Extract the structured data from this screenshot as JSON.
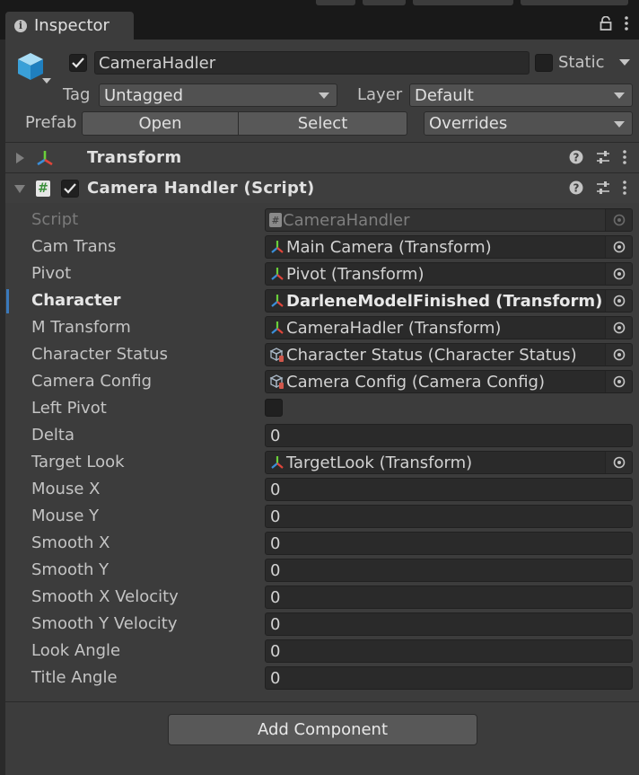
{
  "window": {
    "tab_label": "Inspector",
    "tab_icon": "info-icon"
  },
  "gameobject": {
    "active": true,
    "name": "CameraHadler",
    "static_label": "Static",
    "static_checked": false,
    "tag_label": "Tag",
    "tag_value": "Untagged",
    "layer_label": "Layer",
    "layer_value": "Default",
    "prefab_label": "Prefab",
    "prefab_open": "Open",
    "prefab_select": "Select",
    "prefab_overrides": "Overrides"
  },
  "components": {
    "transform": {
      "title": "Transform",
      "expanded": false
    },
    "camera_handler": {
      "title": "Camera Handler (Script)",
      "expanded": true,
      "enabled": true
    }
  },
  "properties": {
    "script": {
      "label": "Script",
      "value": "CameraHandler"
    },
    "cam_trans": {
      "label": "Cam Trans",
      "value": "Main Camera (Transform)"
    },
    "pivot": {
      "label": "Pivot",
      "value": "Pivot (Transform)"
    },
    "character": {
      "label": "Character",
      "value": "DarleneModelFinished (Transform)"
    },
    "m_transform": {
      "label": "M Transform",
      "value": "CameraHadler (Transform)"
    },
    "character_status": {
      "label": "Character Status",
      "value": "Character Status (Character Status)"
    },
    "camera_config": {
      "label": "Camera Config",
      "value": "Camera Config (Camera Config)"
    },
    "left_pivot": {
      "label": "Left Pivot",
      "checked": false
    },
    "delta": {
      "label": "Delta",
      "value": "0"
    },
    "target_look": {
      "label": "Target Look",
      "value": "TargetLook (Transform)"
    },
    "mouse_x": {
      "label": "Mouse X",
      "value": "0"
    },
    "mouse_y": {
      "label": "Mouse Y",
      "value": "0"
    },
    "smooth_x": {
      "label": "Smooth X",
      "value": "0"
    },
    "smooth_y": {
      "label": "Smooth Y",
      "value": "0"
    },
    "smooth_x_velocity": {
      "label": "Smooth X Velocity",
      "value": "0"
    },
    "smooth_y_velocity": {
      "label": "Smooth Y Velocity",
      "value": "0"
    },
    "look_angle": {
      "label": "Look Angle",
      "value": "0"
    },
    "title_angle": {
      "label": "Title Angle",
      "value": "0"
    }
  },
  "add_component_label": "Add Component",
  "colors": {
    "panel": "#3c3c3c",
    "field": "#2a2a2a",
    "selection": "#3a79bb"
  }
}
